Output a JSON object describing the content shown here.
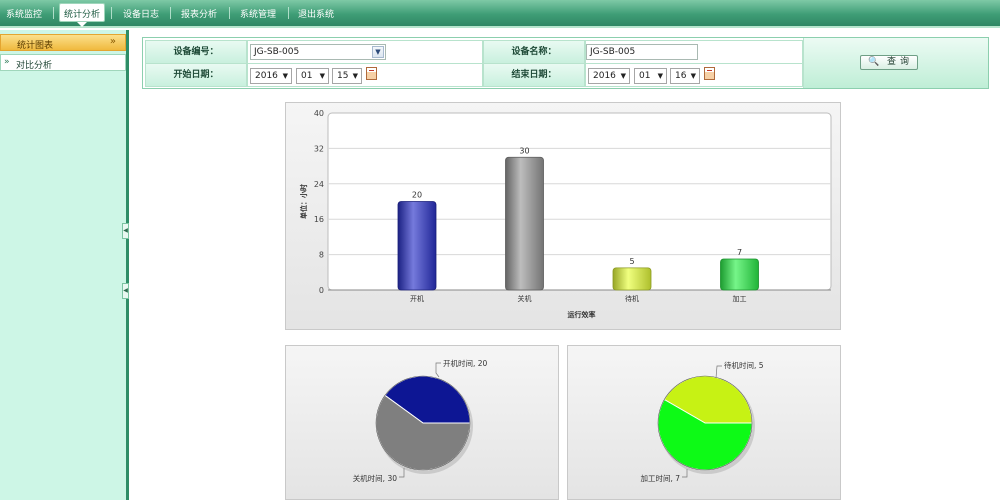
{
  "topnav": {
    "items": [
      "系统监控",
      "统计分析",
      "设备日志",
      "报表分析",
      "系统管理",
      "退出系统"
    ],
    "active": "统计分析"
  },
  "sidebar": {
    "section_title": "统计图表",
    "items": [
      {
        "label": "对比分析"
      }
    ]
  },
  "filter": {
    "device_id_label": "设备编号：",
    "device_id_value": "JG-SB-005",
    "device_name_label": "设备名称：",
    "device_name_value": "JG-SB-005",
    "start_date_label": "开始日期：",
    "start_year": "2016",
    "start_month": "01",
    "start_day": "15",
    "end_date_label": "结束日期：",
    "end_year": "2016",
    "end_month": "01",
    "end_day": "16",
    "query_button": "查询"
  },
  "chart_data": [
    {
      "type": "bar",
      "categories": [
        "开机",
        "关机",
        "待机",
        "加工"
      ],
      "values": [
        20,
        30,
        5,
        7
      ],
      "colors": [
        "#2b33c9",
        "#9a9a9a",
        "#e8ff3a",
        "#2cf04a"
      ],
      "xlabel": "运行效率",
      "ylabel": "单位：小时",
      "ylim": [
        0,
        40
      ],
      "yticks": [
        0,
        8,
        16,
        24,
        32,
        40
      ],
      "grid": true,
      "data_labels": [
        "20",
        "30",
        "5",
        "7"
      ]
    },
    {
      "type": "pie",
      "slices": [
        {
          "label": "开机时间",
          "value": 20,
          "color": "#0d1694",
          "text": "开机时间, 20"
        },
        {
          "label": "关机时间",
          "value": 30,
          "color": "#7f7f7f",
          "text": "关机时间, 30"
        }
      ]
    },
    {
      "type": "pie",
      "slices": [
        {
          "label": "待机时间",
          "value": 5,
          "color": "#c7f214",
          "text": "待机时间, 5"
        },
        {
          "label": "加工时间",
          "value": 7,
          "color": "#0dfa16",
          "text": "加工时间, 7"
        }
      ]
    }
  ]
}
